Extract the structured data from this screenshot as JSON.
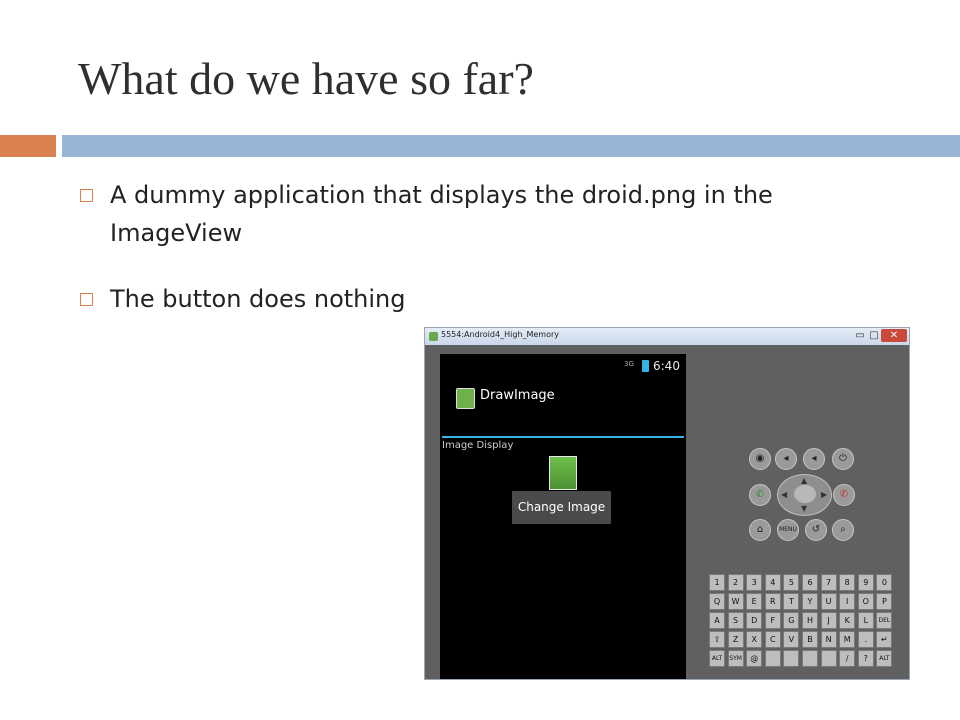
{
  "slide": {
    "title": "What do we have so far?",
    "accent_colors": {
      "orange": "#d9824f",
      "blue": "#97b6d6"
    },
    "bullets": [
      {
        "text": "A dummy application that displays the droid.png in the ImageView"
      },
      {
        "text": "The button does nothing"
      }
    ]
  },
  "emulator": {
    "window_title": "5554:Android4_High_Memory",
    "controls": {
      "minimize": "▭",
      "maximize": "□",
      "close": "✕"
    },
    "status_bar": {
      "signal": "3G",
      "time": "6:40"
    },
    "app": {
      "name": "DrawImage",
      "layout_label": "Image Display",
      "button_label": "Change Image",
      "accent_color": "#33b5e5"
    },
    "hardware_buttons": [
      {
        "name": "camera-icon",
        "glyph": "◉"
      },
      {
        "name": "volume-down-icon",
        "glyph": "◂"
      },
      {
        "name": "volume-up-icon",
        "glyph": "◂"
      },
      {
        "name": "power-icon",
        "glyph": "⏻"
      },
      {
        "name": "call-icon",
        "glyph": "✆"
      },
      {
        "name": "end-call-icon",
        "glyph": "✆"
      },
      {
        "name": "home-icon",
        "glyph": "⌂"
      },
      {
        "name": "menu-icon",
        "glyph": "MENU"
      },
      {
        "name": "back-icon",
        "glyph": "↺"
      },
      {
        "name": "search-icon",
        "glyph": "⌕"
      }
    ],
    "keyboard": {
      "rows": [
        [
          "1",
          "2",
          "3",
          "4",
          "5",
          "6",
          "7",
          "8",
          "9",
          "0"
        ],
        [
          "Q",
          "W",
          "E",
          "R",
          "T",
          "Y",
          "U",
          "I",
          "O",
          "P"
        ],
        [
          "A",
          "S",
          "D",
          "F",
          "G",
          "H",
          "J",
          "K",
          "L",
          "DEL"
        ],
        [
          "⇧",
          "Z",
          "X",
          "C",
          "V",
          "B",
          "N",
          "M",
          ".",
          "↵"
        ],
        [
          "ALT",
          "SYM",
          "@",
          "",
          "",
          "",
          "",
          "/",
          "?",
          "ALT"
        ]
      ]
    }
  }
}
